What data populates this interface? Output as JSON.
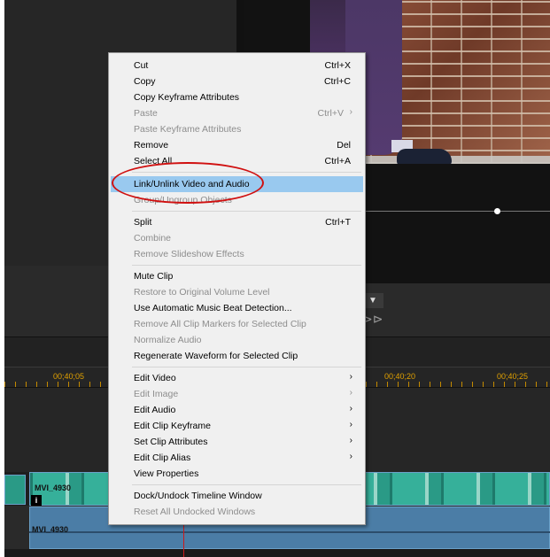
{
  "colors": {
    "menu_background": "#f0f0f0",
    "menu_highlight": "#99c9ef",
    "menu_disabled_text": "#8d8d8d",
    "timecode": "#e0a000",
    "video_clip": "#2a9a86",
    "audio_clip": "#4b7da6",
    "playhead": "#cc1a1a",
    "annotation": "#d01010"
  },
  "timeline": {
    "ruler_labels": [
      "00;40;05",
      "00;40;20",
      "00;40;25"
    ],
    "video_clip_name": "MVI_4930",
    "audio_clip_name": "MVI_4930",
    "info_badge": "i"
  },
  "preview": {
    "play_forward_icon": "fast-forward-icon",
    "dropdown_icon": "triangle-down-icon"
  },
  "context_menu": {
    "items": [
      {
        "label": "Cut",
        "shortcut": "Ctrl+X"
      },
      {
        "label": "Copy",
        "shortcut": "Ctrl+C"
      },
      {
        "label": "Copy Keyframe Attributes",
        "shortcut": ""
      },
      {
        "label": "Paste",
        "shortcut": "Ctrl+V",
        "submenu_arrow": "›"
      },
      {
        "label": "Paste Keyframe Attributes",
        "shortcut": ""
      },
      {
        "label": "Remove",
        "shortcut": "Del"
      },
      {
        "label": "Select All",
        "shortcut": "Ctrl+A"
      },
      {
        "label": "Link/Unlink Video and Audio",
        "shortcut": ""
      },
      {
        "label": "Group/Ungroup Objects",
        "shortcut": ""
      },
      {
        "label": "Split",
        "shortcut": "Ctrl+T"
      },
      {
        "label": "Combine",
        "shortcut": ""
      },
      {
        "label": "Remove Slideshow Effects",
        "shortcut": ""
      },
      {
        "label": "Mute Clip",
        "shortcut": ""
      },
      {
        "label": "Restore to Original Volume Level",
        "shortcut": ""
      },
      {
        "label": "Use Automatic Music Beat Detection...",
        "shortcut": ""
      },
      {
        "label": "Remove All Clip Markers for Selected Clip",
        "shortcut": ""
      },
      {
        "label": "Normalize Audio",
        "shortcut": ""
      },
      {
        "label": "Regenerate Waveform for Selected Clip",
        "shortcut": ""
      },
      {
        "label": "Edit Video",
        "submenu_arrow": "›"
      },
      {
        "label": "Edit Image",
        "submenu_arrow": "›"
      },
      {
        "label": "Edit Audio",
        "submenu_arrow": "›"
      },
      {
        "label": "Edit Clip Keyframe",
        "submenu_arrow": "›"
      },
      {
        "label": "Set Clip Attributes",
        "submenu_arrow": "›"
      },
      {
        "label": "Edit Clip Alias",
        "submenu_arrow": "›"
      },
      {
        "label": "View Properties",
        "shortcut": ""
      },
      {
        "label": "Dock/Undock Timeline Window",
        "shortcut": ""
      },
      {
        "label": "Reset All Undocked Windows",
        "shortcut": ""
      }
    ]
  }
}
